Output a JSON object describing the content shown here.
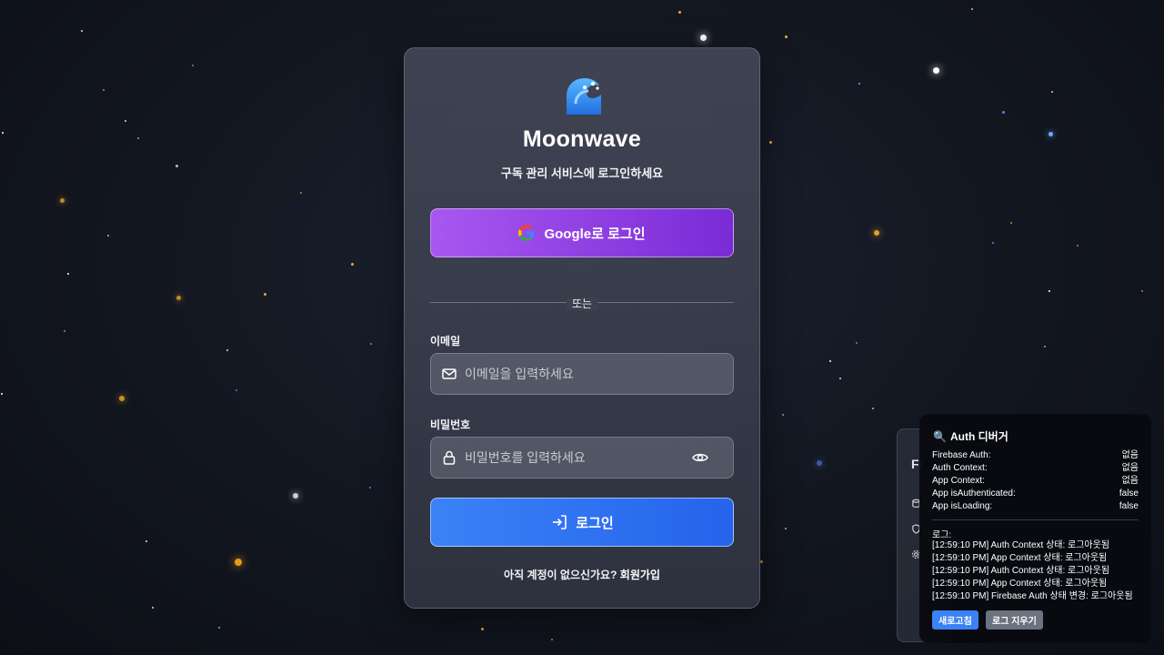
{
  "brand": {
    "name": "Moonwave",
    "subtitle": "구독 관리 서비스에 로그인하세요"
  },
  "google_button": {
    "label": "Google로 로그인"
  },
  "divider_text": "또는",
  "email": {
    "label": "이메일",
    "placeholder": "이메일을 입력하세요",
    "value": ""
  },
  "password": {
    "label": "비밀번호",
    "placeholder": "비밀번호를 입력하세요",
    "value": ""
  },
  "login_button": {
    "label": "로그인"
  },
  "signup": {
    "prompt": "아직 계정이 없으신가요?",
    "link": "회원가입"
  },
  "firebase_panel": {
    "title_fragment": "Fi"
  },
  "debugger": {
    "title": "Auth 디버거",
    "rows": [
      {
        "key": "Firebase Auth:",
        "value": "없음"
      },
      {
        "key": "Auth Context:",
        "value": "없음"
      },
      {
        "key": "App Context:",
        "value": "없음"
      },
      {
        "key": "App isAuthenticated:",
        "value": "false"
      },
      {
        "key": "App isLoading:",
        "value": "false"
      }
    ],
    "log_label": "로그:",
    "logs": [
      "[12:59:10 PM] Auth Context 상태: 로그아웃됨",
      "[12:59:10 PM] App Context 상태: 로그아웃됨",
      "[12:59:10 PM] Auth Context 상태: 로그아웃됨",
      "[12:59:10 PM] App Context 상태: 로그아웃됨",
      "[12:59:10 PM] Firebase Auth 상태 변경: 로그아웃됨"
    ],
    "refresh_label": "새로고침",
    "clear_label": "로그 지우기"
  },
  "colors": {
    "google_gradient": [
      "#a957f0",
      "#7a2bd6"
    ],
    "login_gradient": [
      "#3b82f6",
      "#2563eb"
    ],
    "refresh_button": "#3b82f6",
    "clear_button": "#6b7280"
  },
  "icons": {
    "logo": "wave-logo-icon",
    "google": "google-icon",
    "email": "mail-icon",
    "password": "lock-icon",
    "toggle": "eye-icon",
    "login": "login-arrow-icon",
    "debugger": "magnifier-icon"
  }
}
